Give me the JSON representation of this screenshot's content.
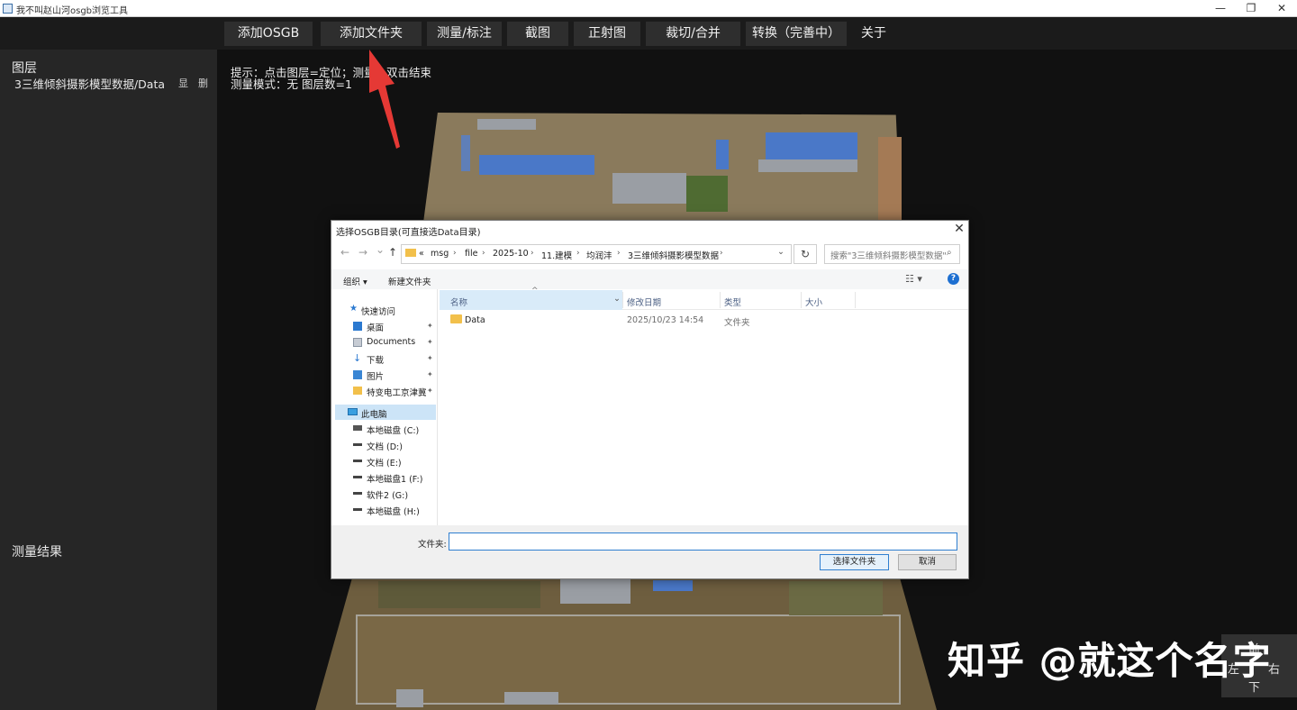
{
  "window": {
    "title": "我不叫赵山河osgb浏览工具",
    "minimize": "—",
    "restore": "❐",
    "close": "✕"
  },
  "toolbar": {
    "buttons": [
      "添加OSGB",
      "添加文件夹",
      "测量/标注",
      "截图",
      "正射图",
      "裁切/合并",
      "转换（完善中）",
      "关于"
    ]
  },
  "left_panel": {
    "layers_title": "图层",
    "layer_item": "3三维倾斜摄影模型数据/Data",
    "layer_show": "显",
    "layer_delete": "删",
    "measure_title": "测量结果"
  },
  "viewport": {
    "hint_line1": "提示：点击图层=定位；测量：双击结束",
    "hint_line2": "测量模式：无  图层数=1"
  },
  "dialog": {
    "title": "选择OSGB目录(可直接选Data目录)",
    "close": "✕",
    "nav": {
      "back": "←",
      "forward": "→",
      "recent": "⌄",
      "up": "↑"
    },
    "breadcrumb": [
      "«",
      "msg",
      "file",
      "2025-10",
      "11.建模",
      "均润沣",
      "3三维倾斜摄影模型数据"
    ],
    "breadcrumb_sep": "›",
    "dropdown": "⌄",
    "refresh": "↻",
    "search_placeholder": "搜索\"3三维倾斜摄影模型数据\"",
    "search_icon": "⌕",
    "organize": "组织 ▾",
    "new_folder": "新建文件夹",
    "view_icon": "☷ ▾",
    "help": "?",
    "nav_pane": [
      {
        "label": "快速访问",
        "icon": "star-icon",
        "pinned": false
      },
      {
        "label": "桌面",
        "icon": "desktop-icon",
        "pinned": true
      },
      {
        "label": "Documents",
        "icon": "documents-icon",
        "pinned": true
      },
      {
        "label": "下载",
        "icon": "download-icon",
        "pinned": true
      },
      {
        "label": "图片",
        "icon": "pictures-icon",
        "pinned": true
      },
      {
        "label": "特变电工京津冀",
        "icon": "folder-icon",
        "pinned": true
      },
      {
        "label": "此电脑",
        "icon": "computer-icon",
        "pinned": false
      },
      {
        "label": "本地磁盘 (C:)",
        "icon": "drive-icon",
        "pinned": false
      },
      {
        "label": "文档 (D:)",
        "icon": "drive-icon",
        "pinned": false
      },
      {
        "label": "文档 (E:)",
        "icon": "drive-icon",
        "pinned": false
      },
      {
        "label": "本地磁盘1 (F:)",
        "icon": "drive-icon",
        "pinned": false
      },
      {
        "label": "软件2 (G:)",
        "icon": "drive-icon",
        "pinned": false
      },
      {
        "label": "本地磁盘 (H:)",
        "icon": "drive-icon",
        "pinned": false
      }
    ],
    "pin_glyph": "📌",
    "columns": [
      "名称",
      "修改日期",
      "类型",
      "大小"
    ],
    "sort_glyph": "^",
    "col_dropdown": "⌄",
    "rows": [
      {
        "name": "Data",
        "modified": "2025/10/23 14:54",
        "type": "文件夹",
        "size": ""
      }
    ],
    "folder_label": "文件夹:",
    "folder_value": "",
    "ok": "选择文件夹",
    "cancel": "取消"
  },
  "watermark": "知乎 @就这个名字",
  "dpad": {
    "left": "左",
    "front": "前",
    "right": "右",
    "down": "下"
  },
  "colors": {
    "accent": "#2f7fd0",
    "toolbar_bg": "#1b1b1b",
    "arrow": "#e53935"
  }
}
